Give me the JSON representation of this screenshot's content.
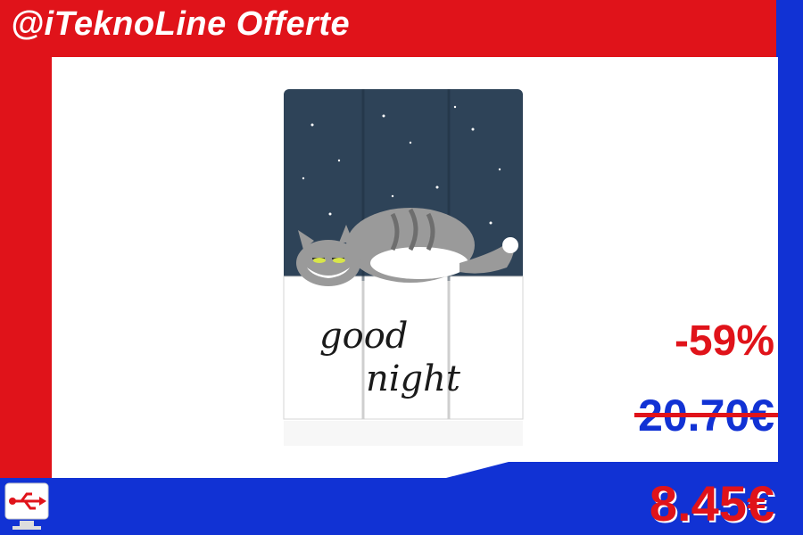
{
  "brand": {
    "title": "@iTeknoLine Offerte"
  },
  "offer": {
    "discount": "-59%",
    "old_price": "20.70€",
    "new_price": "8.45€"
  },
  "product_image": {
    "line1": "good",
    "line2": "night"
  },
  "colors": {
    "red": "#e0131a",
    "blue": "#1132d4",
    "case_navy": "#2e4358"
  },
  "icons": {
    "logo": "usb-monitor-icon"
  }
}
